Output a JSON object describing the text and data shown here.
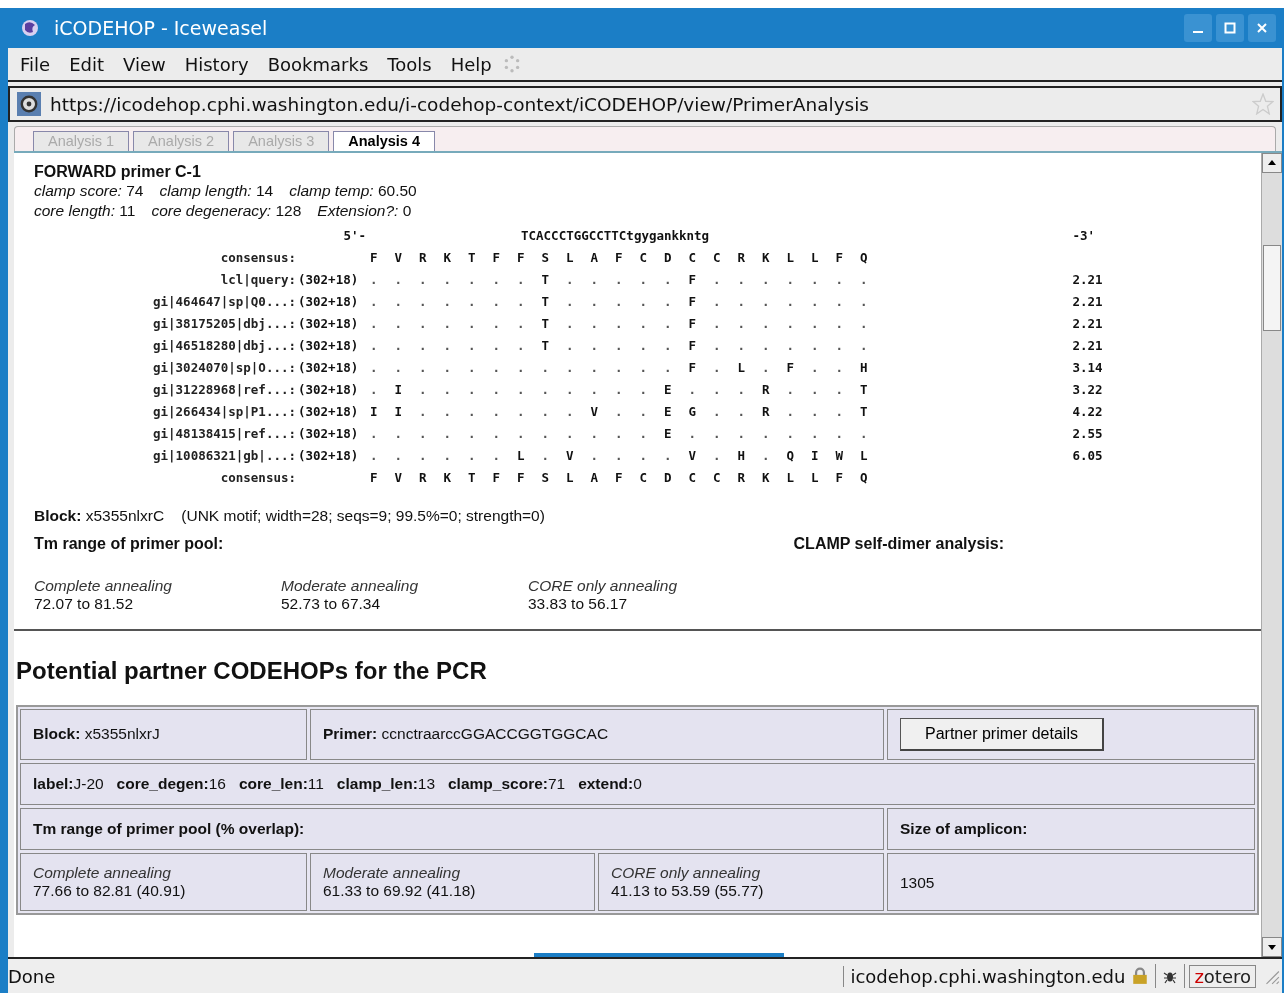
{
  "window": {
    "title": "iCODEHOP - Iceweasel"
  },
  "menu": [
    "File",
    "Edit",
    "View",
    "History",
    "Bookmarks",
    "Tools",
    "Help"
  ],
  "url": "https://icodehop.cphi.washington.edu/i-codehop-context/iCODEHOP/view/PrimerAnalysis",
  "tabs": [
    {
      "label": "Analysis 1",
      "selected": false
    },
    {
      "label": "Analysis 2",
      "selected": false
    },
    {
      "label": "Analysis 3",
      "selected": false
    },
    {
      "label": "Analysis 4",
      "selected": true
    }
  ],
  "primer": {
    "title": "FORWARD primer C-1",
    "stats": [
      [
        {
          "label": "clamp score:",
          "value": "74"
        },
        {
          "label": "clamp length:",
          "value": "14"
        },
        {
          "label": "clamp temp:",
          "value": "60.50"
        }
      ],
      [
        {
          "label": "core length:",
          "value": "11"
        },
        {
          "label": "core degeneracy:",
          "value": "128"
        },
        {
          "label": "Extension?:",
          "value": "0"
        }
      ]
    ]
  },
  "alignment": {
    "five_prime": "5'-",
    "sequence": "TCACCCTGGCCTTCtgygankkntg",
    "three_prime": "-3'",
    "consensus_label": "consensus:",
    "consensus": [
      "F",
      "V",
      "R",
      "K",
      "T",
      "F",
      "F",
      "S",
      "L",
      "A",
      "F",
      "C",
      "D",
      "C",
      "C",
      "R",
      "K",
      "L",
      "L",
      "F",
      "Q"
    ],
    "rows": [
      {
        "name": "lcl|query:",
        "range": "(302+18)",
        "residues": [
          ".",
          ".",
          ".",
          ".",
          ".",
          ".",
          ".",
          "T",
          ".",
          ".",
          ".",
          ".",
          ".",
          "F",
          ".",
          ".",
          ".",
          ".",
          ".",
          ".",
          "."
        ],
        "score": "2.21"
      },
      {
        "name": "gi|464647|sp|Q0...:",
        "range": "(302+18)",
        "residues": [
          ".",
          ".",
          ".",
          ".",
          ".",
          ".",
          ".",
          "T",
          ".",
          ".",
          ".",
          ".",
          ".",
          "F",
          ".",
          ".",
          ".",
          ".",
          ".",
          ".",
          "."
        ],
        "score": "2.21"
      },
      {
        "name": "gi|38175205|dbj...:",
        "range": "(302+18)",
        "residues": [
          ".",
          ".",
          ".",
          ".",
          ".",
          ".",
          ".",
          "T",
          ".",
          ".",
          ".",
          ".",
          ".",
          "F",
          ".",
          ".",
          ".",
          ".",
          ".",
          ".",
          "."
        ],
        "score": "2.21"
      },
      {
        "name": "gi|46518280|dbj...:",
        "range": "(302+18)",
        "residues": [
          ".",
          ".",
          ".",
          ".",
          ".",
          ".",
          ".",
          "T",
          ".",
          ".",
          ".",
          ".",
          ".",
          "F",
          ".",
          ".",
          ".",
          ".",
          ".",
          ".",
          "."
        ],
        "score": "2.21"
      },
      {
        "name": "gi|3024070|sp|O...:",
        "range": "(302+18)",
        "residues": [
          ".",
          ".",
          ".",
          ".",
          ".",
          ".",
          ".",
          ".",
          ".",
          ".",
          ".",
          ".",
          ".",
          "F",
          ".",
          "L",
          ".",
          "F",
          ".",
          ".",
          "H"
        ],
        "score": "3.14"
      },
      {
        "name": "gi|31228968|ref...:",
        "range": "(302+18)",
        "residues": [
          ".",
          "I",
          ".",
          ".",
          ".",
          ".",
          ".",
          ".",
          ".",
          ".",
          ".",
          ".",
          "E",
          ".",
          ".",
          ".",
          "R",
          ".",
          ".",
          ".",
          "T"
        ],
        "score": "3.22"
      },
      {
        "name": "gi|266434|sp|P1...:",
        "range": "(302+18)",
        "residues": [
          "I",
          "I",
          ".",
          ".",
          ".",
          ".",
          ".",
          ".",
          ".",
          "V",
          ".",
          ".",
          "E",
          "G",
          ".",
          ".",
          "R",
          ".",
          ".",
          ".",
          "T"
        ],
        "score": "4.22"
      },
      {
        "name": "gi|48138415|ref...:",
        "range": "(302+18)",
        "residues": [
          ".",
          ".",
          ".",
          ".",
          ".",
          ".",
          ".",
          ".",
          ".",
          ".",
          ".",
          ".",
          "E",
          ".",
          ".",
          ".",
          ".",
          ".",
          ".",
          ".",
          "."
        ],
        "score": "2.55"
      },
      {
        "name": "gi|10086321|gb|...:",
        "range": "(302+18)",
        "residues": [
          ".",
          ".",
          ".",
          ".",
          ".",
          ".",
          "L",
          ".",
          "V",
          ".",
          ".",
          ".",
          ".",
          "V",
          ".",
          "H",
          ".",
          "Q",
          "I",
          "W",
          "L"
        ],
        "score": "6.05"
      }
    ],
    "consensus_bottom_label": "consensus:",
    "consensus_bottom": [
      "F",
      "V",
      "R",
      "K",
      "T",
      "F",
      "F",
      "S",
      "L",
      "A",
      "F",
      "C",
      "D",
      "C",
      "C",
      "R",
      "K",
      "L",
      "L",
      "F",
      "Q"
    ]
  },
  "block": "**Block:** x5355nlxrC    (UNK motif; width=28; seqs=9; 99.5%=0; strength=0)",
  "tm_heading": "Tm range of primer pool:",
  "dimer_heading": "CLAMP self-dimer analysis:",
  "tm": [
    {
      "label": "Complete annealing",
      "value": "72.07 to 81.52"
    },
    {
      "label": "Moderate annealing",
      "value": "52.73 to 67.34"
    },
    {
      "label": "CORE only annealing",
      "value": "33.83 to 56.17"
    }
  ],
  "partners": {
    "heading": "Potential partner CODEHOPs for the PCR",
    "block": "**Block:** x5355nlxrJ",
    "primer": "**Primer:** ccnctraarccGGACCGGTGGCAC",
    "button": "Partner primer details",
    "details": "**label:**J-20   **core_degen:**16   **core_len:**11   **clamp_len:**13   **clamp_score:**71   **extend:**0",
    "tm_heading": "Tm range of primer pool (% overlap):",
    "size_heading": "Size of amplicon:",
    "tm": [
      {
        "label": "Complete annealing",
        "value": "77.66 to 82.81 (40.91)"
      },
      {
        "label": "Moderate annealing",
        "value": "61.33 to 69.92 (41.18)"
      },
      {
        "label": "CORE only annealing",
        "value": "41.13 to 53.59 (55.77)"
      }
    ],
    "size": "1305"
  },
  "status": {
    "text": "Done",
    "host": "icodehop.cphi.washington.edu",
    "addon": "zotero"
  }
}
